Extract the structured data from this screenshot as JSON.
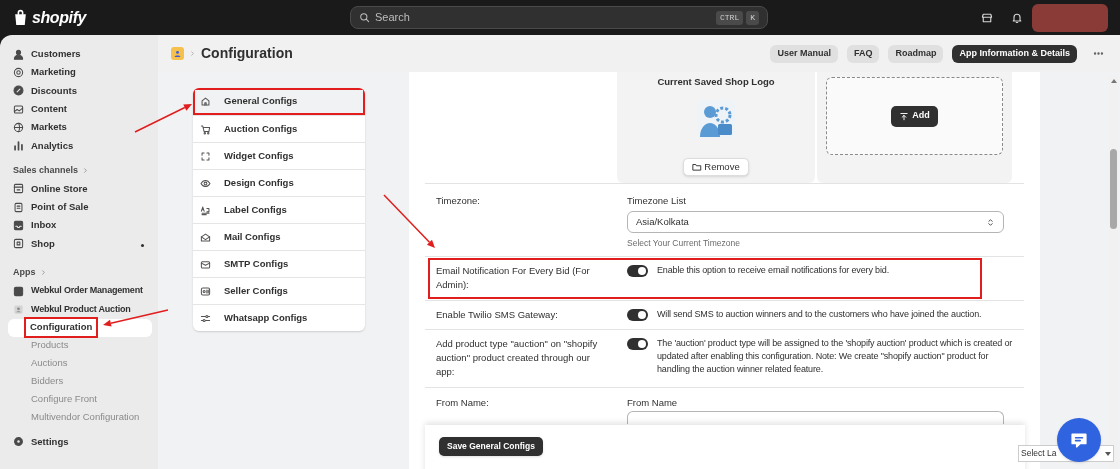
{
  "top_bar": {
    "logo_text": "shopify",
    "search": {
      "placeholder": "Search",
      "shortcut": [
        "CTRL",
        "K"
      ]
    }
  },
  "sidebar": {
    "items": [
      {
        "kind": "item",
        "label": "Customers",
        "selected": false
      },
      {
        "kind": "item",
        "label": "Marketing",
        "selected": false
      },
      {
        "kind": "item",
        "label": "Discounts",
        "selected": false
      },
      {
        "kind": "item",
        "label": "Content",
        "selected": false
      },
      {
        "kind": "item",
        "label": "Markets",
        "selected": false
      },
      {
        "kind": "item",
        "label": "Analytics",
        "selected": false
      },
      {
        "kind": "heading",
        "label": "Sales channels"
      },
      {
        "kind": "item",
        "label": "Online Store",
        "selected": false
      },
      {
        "kind": "item",
        "label": "Point of Sale",
        "selected": false
      },
      {
        "kind": "item",
        "label": "Inbox",
        "selected": false
      },
      {
        "kind": "item",
        "label": "Shop",
        "selected": false
      },
      {
        "kind": "heading",
        "label": "Apps"
      },
      {
        "kind": "item",
        "label": "Webkul Order Management",
        "selected": false
      },
      {
        "kind": "item",
        "label": "Webkul Product Auction",
        "selected": false
      },
      {
        "kind": "subitem",
        "label": "Configuration",
        "selected": true,
        "annotated": true
      },
      {
        "kind": "subitem",
        "label": "Products",
        "selected": false
      },
      {
        "kind": "subitem",
        "label": "Auctions",
        "selected": false
      },
      {
        "kind": "subitem",
        "label": "Bidders",
        "selected": false
      },
      {
        "kind": "subitem",
        "label": "Configure Front",
        "selected": false
      },
      {
        "kind": "subitem",
        "label": "Multivendor Configuration",
        "selected": false
      },
      {
        "kind": "bottom",
        "label": "Settings",
        "selected": false
      }
    ]
  },
  "page_header": {
    "title": "Configuration",
    "buttons": [
      {
        "label": "User Manual",
        "primary": false
      },
      {
        "label": "FAQ",
        "primary": false
      },
      {
        "label": "Roadmap",
        "primary": false
      },
      {
        "label": "App Information & Details",
        "primary": true
      }
    ]
  },
  "config_menu": {
    "items": [
      {
        "label": "General Configs",
        "selected": true,
        "annotated": true
      },
      {
        "label": "Auction Configs",
        "selected": false,
        "annotated": false
      },
      {
        "label": "Widget Configs",
        "selected": false,
        "annotated": false
      },
      {
        "label": "Design Configs",
        "selected": false,
        "annotated": false
      },
      {
        "label": "Label Configs",
        "selected": false,
        "annotated": false
      },
      {
        "label": "Mail Configs",
        "selected": false,
        "annotated": false
      },
      {
        "label": "SMTP Configs",
        "selected": false,
        "annotated": false
      },
      {
        "label": "Seller Configs",
        "selected": false,
        "annotated": false
      },
      {
        "label": "Whatsapp Configs",
        "selected": false,
        "annotated": false
      }
    ]
  },
  "form": {
    "logo": {
      "title": "Current Saved Shop Logo",
      "remove_button": "Remove",
      "add_button": "Add"
    },
    "rows": [
      {
        "kind": "select",
        "label": "Timezone:",
        "field_label": "Timezone List",
        "value": "Asia/Kolkata",
        "hint": "Select Your Current Timezone"
      },
      {
        "kind": "toggle",
        "label": "Email Notification For Every Bid (For Admin):",
        "on": true,
        "description": "Enable this option to receive email notifications for every bid.",
        "annotated": true
      },
      {
        "kind": "toggle",
        "label": "Enable Twilio SMS Gateway:",
        "on": true,
        "description": "Will send SMS to auction winners and to the customers who have joined the auction.",
        "annotated": false
      },
      {
        "kind": "toggle",
        "label": "Add product type \"auction\" on \"shopify auction\" product created through our app:",
        "on": true,
        "description": "The 'auction' product type will be assigned to the 'shopify auction' product which is created or updated after enabling this configuration. Note: We create \"shopify auction\" product for handling the auction winner related feature.",
        "annotated": false
      },
      {
        "kind": "text",
        "label": "From Name:",
        "field_label": "From Name"
      }
    ],
    "save_button": "Save General Configs"
  },
  "language_select": {
    "value": "Select La"
  }
}
